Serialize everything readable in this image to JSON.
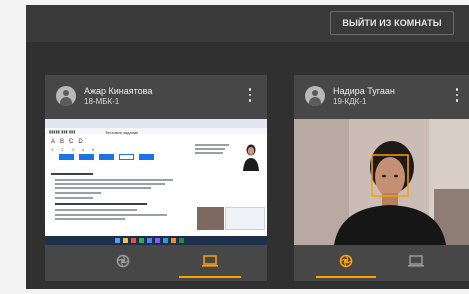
{
  "header": {
    "leave_button": "ВЫЙТИ ИЗ КОМНАТЫ"
  },
  "participants": [
    {
      "name": "Ажар Кинаятова",
      "group": "18-МБК-1",
      "avatar_icon": "person-icon",
      "menu_icon": "more-vert-icon",
      "view": "screen-share",
      "active_control": "screen",
      "screen_share_text": {
        "tab_text": "Тестовое задание",
        "options": [
          "A",
          "B",
          "C",
          "D"
        ],
        "numbers": [
          "1",
          "2",
          "3",
          "4",
          "5"
        ]
      }
    },
    {
      "name": "Надира Тугаан",
      "group": "19-КДК-1",
      "avatar_icon": "person-icon",
      "menu_icon": "more-vert-icon",
      "view": "camera",
      "active_control": "camera"
    }
  ],
  "controls": {
    "camera_icon": "camera-aperture-icon",
    "screen_icon": "laptop-icon"
  },
  "colors": {
    "background": "#303030",
    "tile": "#474747",
    "accent": "#ffa000",
    "face_box": "#f4a300"
  }
}
